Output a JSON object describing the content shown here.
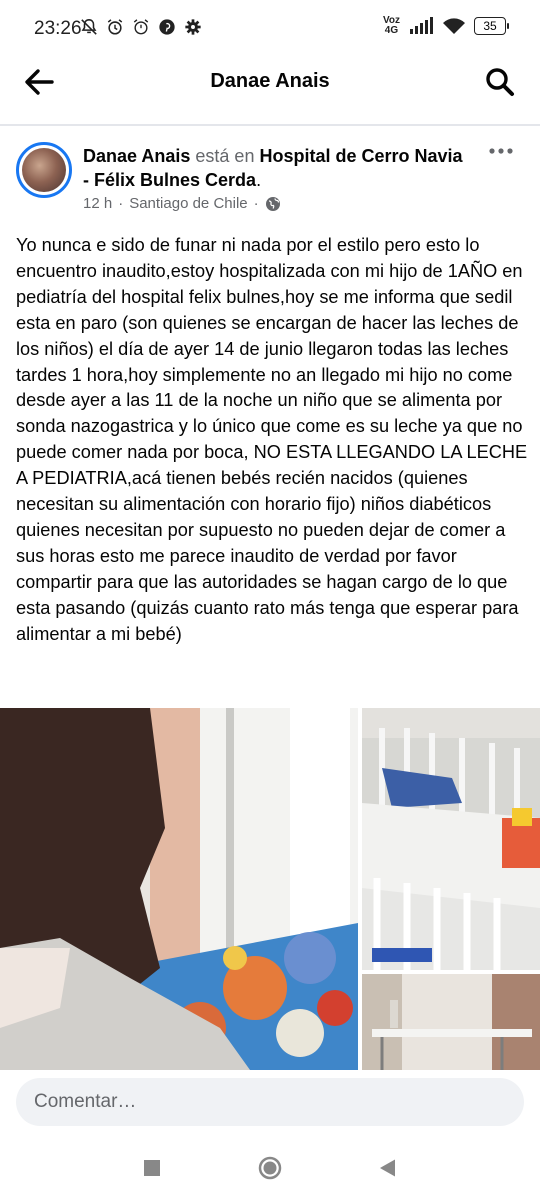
{
  "status_bar": {
    "time": "23:26",
    "network_label_top": "Voz",
    "network_label_bottom": "4G",
    "battery": "35"
  },
  "app_bar": {
    "title": "Danae Anais"
  },
  "post": {
    "author": "Danae Anais",
    "connector": "está en",
    "location": "Hospital de Cerro Navia -  Félix Bulnes Cerda",
    "time": "12 h",
    "separator": "·",
    "place": "Santiago de Chile",
    "body": "Yo nunca e sido de funar ni nada por el estilo pero esto lo encuentro inaudito,estoy hospitalizada con mi hijo de 1AÑO en pediatría del hospital felix bulnes,hoy se me informa que sedil esta en paro (son quienes se encargan de hacer las leches de los niños) el día de ayer 14 de junio llegaron todas las leches tardes 1 hora,hoy simplemente no an llegado mi hijo no come desde ayer a las 11 de la noche un niño que se alimenta por sonda nazogastrica y lo único que come es su leche ya que no puede comer nada por boca, NO ESTA LLEGANDO LA LECHE A PEDIATRIA,acá tienen bebés recién nacidos (quienes necesitan su alimentación con horario fijo) niños diabéticos quienes necesitan  por supuesto no pueden dejar de comer a sus horas esto me parece inaudito de verdad por favor compartir para que las autoridades se hagan cargo de lo que esta pasando (quizás cuanto rato más tenga que esperar para alimentar a mi bebé)"
  },
  "comment": {
    "placeholder": "Comentar…"
  },
  "icons": {
    "back": "arrow-left-icon",
    "search": "search-icon",
    "more": "more-dots-icon",
    "globe": "globe-icon",
    "nav_recents": "square-icon",
    "nav_home": "circle-icon",
    "nav_back": "triangle-back-icon"
  },
  "colors": {
    "accent": "#1877f2",
    "muted": "#65676b",
    "input_bg": "#f0f2f5"
  }
}
